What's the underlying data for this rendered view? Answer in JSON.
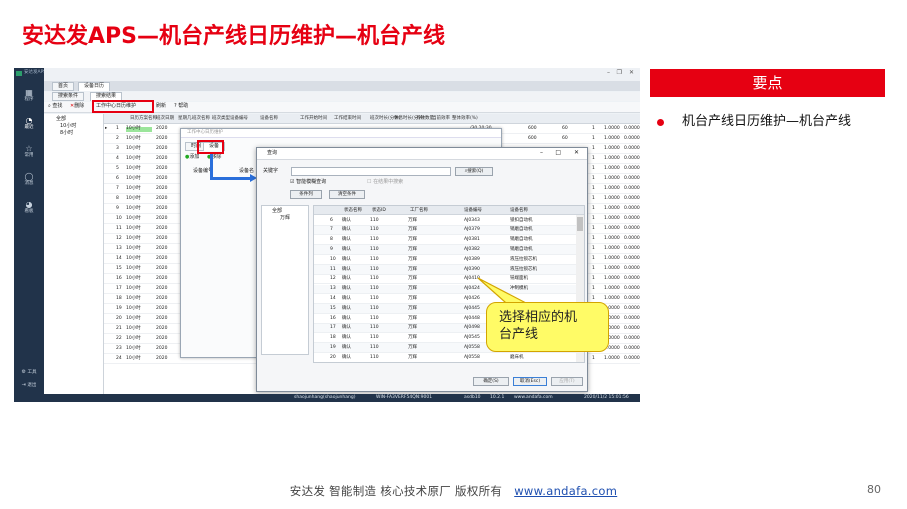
{
  "slide": {
    "title": "安达发APS—机台产线日历维护—机台产线",
    "right_heading": "要点",
    "bullet_text": "机台产线日历维护—机台产线",
    "callout_line1": "选择相应的机",
    "callout_line2": "台产线",
    "footer_text": "安达发  智能制造 核心技术原厂   版权所有",
    "footer_link": "www.andafa.com",
    "page_number": "80",
    "colors": {
      "title_red": "#e60012",
      "heading_red": "#e60012",
      "callout_yellow": "#fffb66",
      "arrow_blue": "#2a6fdb"
    }
  },
  "app": {
    "title": "安达发APS智能制造管理软件",
    "nav": [
      {
        "icon": "grid-icon",
        "label": "程序"
      },
      {
        "icon": "clock-icon",
        "label": "最近"
      },
      {
        "icon": "star-icon",
        "label": "常用"
      },
      {
        "icon": "message-icon",
        "label": "消息"
      },
      {
        "icon": "dashboard-icon",
        "label": "看板"
      }
    ],
    "bottom_nav": [
      {
        "icon": "gear-icon",
        "label": "工具"
      },
      {
        "icon": "exit-icon",
        "label": "退出"
      }
    ],
    "tabs": [
      "首页",
      "设备日历"
    ],
    "subtabs": [
      "搜索条件",
      "搜索结果"
    ],
    "toolbar": [
      "查找",
      "删除",
      "工作中心日历维护",
      "刷新",
      "帮助"
    ],
    "tree": [
      "全部",
      "10小时",
      "8小时"
    ],
    "grid_headers": [
      "日历方案名称",
      "班次日期",
      "星期几",
      "班次名称",
      "班次类型",
      "设备编号",
      "设备名称",
      "工作开始时间",
      "工作结束时间",
      "班次时长(分钟)",
      "休息时长(分钟)",
      "有效数量",
      "当前效率",
      "整体效率(%)"
    ],
    "grid_rows": [
      {
        "no": "1",
        "name": "10小时",
        "date": "2020"
      },
      {
        "no": "2",
        "name": "10小时",
        "date": "2020"
      },
      {
        "no": "3",
        "name": "10小时",
        "date": "2020"
      },
      {
        "no": "4",
        "name": "10小时",
        "date": "2020"
      },
      {
        "no": "5",
        "name": "10小时",
        "date": "2020"
      },
      {
        "no": "6",
        "name": "10小时",
        "date": "2020"
      },
      {
        "no": "7",
        "name": "10小时",
        "date": "2020"
      },
      {
        "no": "8",
        "name": "10小时",
        "date": "2020"
      },
      {
        "no": "9",
        "name": "10小时",
        "date": "2020"
      },
      {
        "no": "10",
        "name": "10小时",
        "date": "2020"
      },
      {
        "no": "11",
        "name": "10小时",
        "date": "2020"
      },
      {
        "no": "12",
        "name": "10小时",
        "date": "2020"
      },
      {
        "no": "13",
        "name": "10小时",
        "date": "2020"
      },
      {
        "no": "14",
        "name": "10小时",
        "date": "2020"
      },
      {
        "no": "15",
        "name": "10小时",
        "date": "2020"
      },
      {
        "no": "16",
        "name": "10小时",
        "date": "2020"
      },
      {
        "no": "17",
        "name": "10小时",
        "date": "2020"
      },
      {
        "no": "18",
        "name": "10小时",
        "date": "2020"
      },
      {
        "no": "19",
        "name": "10小时",
        "date": "2020"
      },
      {
        "no": "20",
        "name": "10小时",
        "date": "2020"
      },
      {
        "no": "21",
        "name": "10小时",
        "date": "2020"
      },
      {
        "no": "22",
        "name": "10小时",
        "date": "2020"
      },
      {
        "no": "23",
        "name": "10小时",
        "date": "2020"
      },
      {
        "no": "24",
        "name": "10小时",
        "date": "2020"
      }
    ],
    "grid_right_rows": [
      {
        "end": "/30 20:30",
        "len": "600",
        "rest": "60",
        "qty": "1",
        "eff": "1.0000",
        "all": "0.0000"
      },
      {
        "end": "/30 20:30",
        "len": "600",
        "rest": "60",
        "qty": "1",
        "eff": "1.0000",
        "all": "0.0000"
      },
      {
        "end": "",
        "len": "",
        "rest": "",
        "qty": "1",
        "eff": "1.0000",
        "all": "0.0000"
      },
      {
        "end": "",
        "len": "",
        "rest": "",
        "qty": "1",
        "eff": "1.0000",
        "all": "0.0000"
      },
      {
        "end": "",
        "len": "",
        "rest": "",
        "qty": "1",
        "eff": "1.0000",
        "all": "0.0000"
      },
      {
        "end": "",
        "len": "",
        "rest": "",
        "qty": "1",
        "eff": "1.0000",
        "all": "0.0000"
      },
      {
        "end": "",
        "len": "",
        "rest": "",
        "qty": "1",
        "eff": "1.0000",
        "all": "0.0000"
      },
      {
        "end": "",
        "len": "",
        "rest": "",
        "qty": "1",
        "eff": "1.0000",
        "all": "0.0000"
      },
      {
        "end": "",
        "len": "",
        "rest": "",
        "qty": "1",
        "eff": "1.0000",
        "all": "0.0000"
      },
      {
        "end": "",
        "len": "",
        "rest": "",
        "qty": "1",
        "eff": "1.0000",
        "all": "0.0000"
      },
      {
        "end": "",
        "len": "",
        "rest": "",
        "qty": "1",
        "eff": "1.0000",
        "all": "0.0000"
      },
      {
        "end": "",
        "len": "",
        "rest": "",
        "qty": "1",
        "eff": "1.0000",
        "all": "0.0000"
      },
      {
        "end": "",
        "len": "",
        "rest": "",
        "qty": "1",
        "eff": "1.0000",
        "all": "0.0000"
      },
      {
        "end": "",
        "len": "",
        "rest": "",
        "qty": "1",
        "eff": "1.0000",
        "all": "0.0000"
      },
      {
        "end": "",
        "len": "",
        "rest": "",
        "qty": "1",
        "eff": "1.0000",
        "all": "0.0000"
      },
      {
        "end": "",
        "len": "",
        "rest": "",
        "qty": "1",
        "eff": "1.0000",
        "all": "0.0000"
      },
      {
        "end": "",
        "len": "",
        "rest": "",
        "qty": "1",
        "eff": "1.0000",
        "all": "0.0000"
      },
      {
        "end": "",
        "len": "",
        "rest": "",
        "qty": "1",
        "eff": "1.0000",
        "all": "0.0000"
      },
      {
        "end": "",
        "len": "",
        "rest": "",
        "qty": "1",
        "eff": "1.0000",
        "all": "0.0000"
      },
      {
        "end": "",
        "len": "",
        "rest": "",
        "qty": "1",
        "eff": "1.0000",
        "all": "0.0000"
      },
      {
        "end": "",
        "len": "",
        "rest": "",
        "qty": "1",
        "eff": "1.0000",
        "all": "0.0000"
      },
      {
        "end": "",
        "len": "",
        "rest": "",
        "qty": "1",
        "eff": "1.0000",
        "all": "0.0000"
      },
      {
        "end": "",
        "len": "",
        "rest": "",
        "qty": "1",
        "eff": "1.0000",
        "all": "0.0000"
      },
      {
        "end": "",
        "len": "",
        "rest": "",
        "qty": "1",
        "eff": "1.0000",
        "all": "0.0000"
      }
    ],
    "status": [
      "shaojunhang(shaojunhang)",
      "WIN-FA3VERF54QN:9001",
      "asdb10",
      "10.2.1",
      "www.andafa.com",
      "2020/11/2 15:01:56"
    ]
  },
  "dialog_calendar": {
    "title": "工作中心日历维护",
    "tabs": [
      "时间",
      "设备"
    ],
    "actions": [
      "添加",
      "移除"
    ],
    "headers": [
      "设备编号",
      "设备名"
    ]
  },
  "dialog_query": {
    "title": "查询",
    "keyword_label": "关键字",
    "search_button": "搜索(Q)",
    "fuzzy_label": "智能模糊查询",
    "in_result_label": "在结果中搜索",
    "condition_button": "条件列",
    "clear_button": "清空条件",
    "tree": [
      "全部",
      "万辉"
    ],
    "headers": [
      "状态名称",
      "状态ID",
      "工厂名称",
      "设备编号",
      "设备名称"
    ],
    "rows": [
      {
        "no": "6",
        "status": "确认",
        "id": "110",
        "factory": "万辉",
        "code": "AJ0343",
        "name": "锁扣自动机"
      },
      {
        "no": "7",
        "status": "确认",
        "id": "110",
        "factory": "万辉",
        "code": "AJ0379",
        "name": "销磨自动机"
      },
      {
        "no": "8",
        "status": "确认",
        "id": "110",
        "factory": "万辉",
        "code": "AJ0381",
        "name": "销磨自动机"
      },
      {
        "no": "9",
        "status": "确认",
        "id": "110",
        "factory": "万辉",
        "code": "AJ0382",
        "name": "销磨自动机"
      },
      {
        "no": "10",
        "status": "确认",
        "id": "110",
        "factory": "万辉",
        "code": "AJ0389",
        "name": "液压拉锁芯机"
      },
      {
        "no": "11",
        "status": "确认",
        "id": "110",
        "factory": "万辉",
        "code": "AJ0390",
        "name": "液压拉锁芯机"
      },
      {
        "no": "12",
        "status": "确认",
        "id": "110",
        "factory": "万辉",
        "code": "AJ0410",
        "name": "铣端面机"
      },
      {
        "no": "13",
        "status": "确认",
        "id": "110",
        "factory": "万辉",
        "code": "AJ0424",
        "name": "冲制模机"
      },
      {
        "no": "14",
        "status": "确认",
        "id": "110",
        "factory": "万辉",
        "code": "AJ0426",
        "name": ""
      },
      {
        "no": "15",
        "status": "确认",
        "id": "110",
        "factory": "万辉",
        "code": "AJ0445",
        "name": ""
      },
      {
        "no": "16",
        "status": "确认",
        "id": "110",
        "factory": "万辉",
        "code": "AJ0448",
        "name": ""
      },
      {
        "no": "17",
        "status": "确认",
        "id": "110",
        "factory": "万辉",
        "code": "AJ0498",
        "name": ""
      },
      {
        "no": "18",
        "status": "确认",
        "id": "110",
        "factory": "万辉",
        "code": "AJ0545",
        "name": ""
      },
      {
        "no": "19",
        "status": "确认",
        "id": "110",
        "factory": "万辉",
        "code": "AJ0558",
        "name": ""
      },
      {
        "no": "20",
        "status": "确认",
        "id": "110",
        "factory": "万辉",
        "code": "AJ0558",
        "name": "磨床机"
      }
    ],
    "ok_button": "确定(S)",
    "cancel_button": "取消(Esc)",
    "apply_button": "应用(T)"
  }
}
